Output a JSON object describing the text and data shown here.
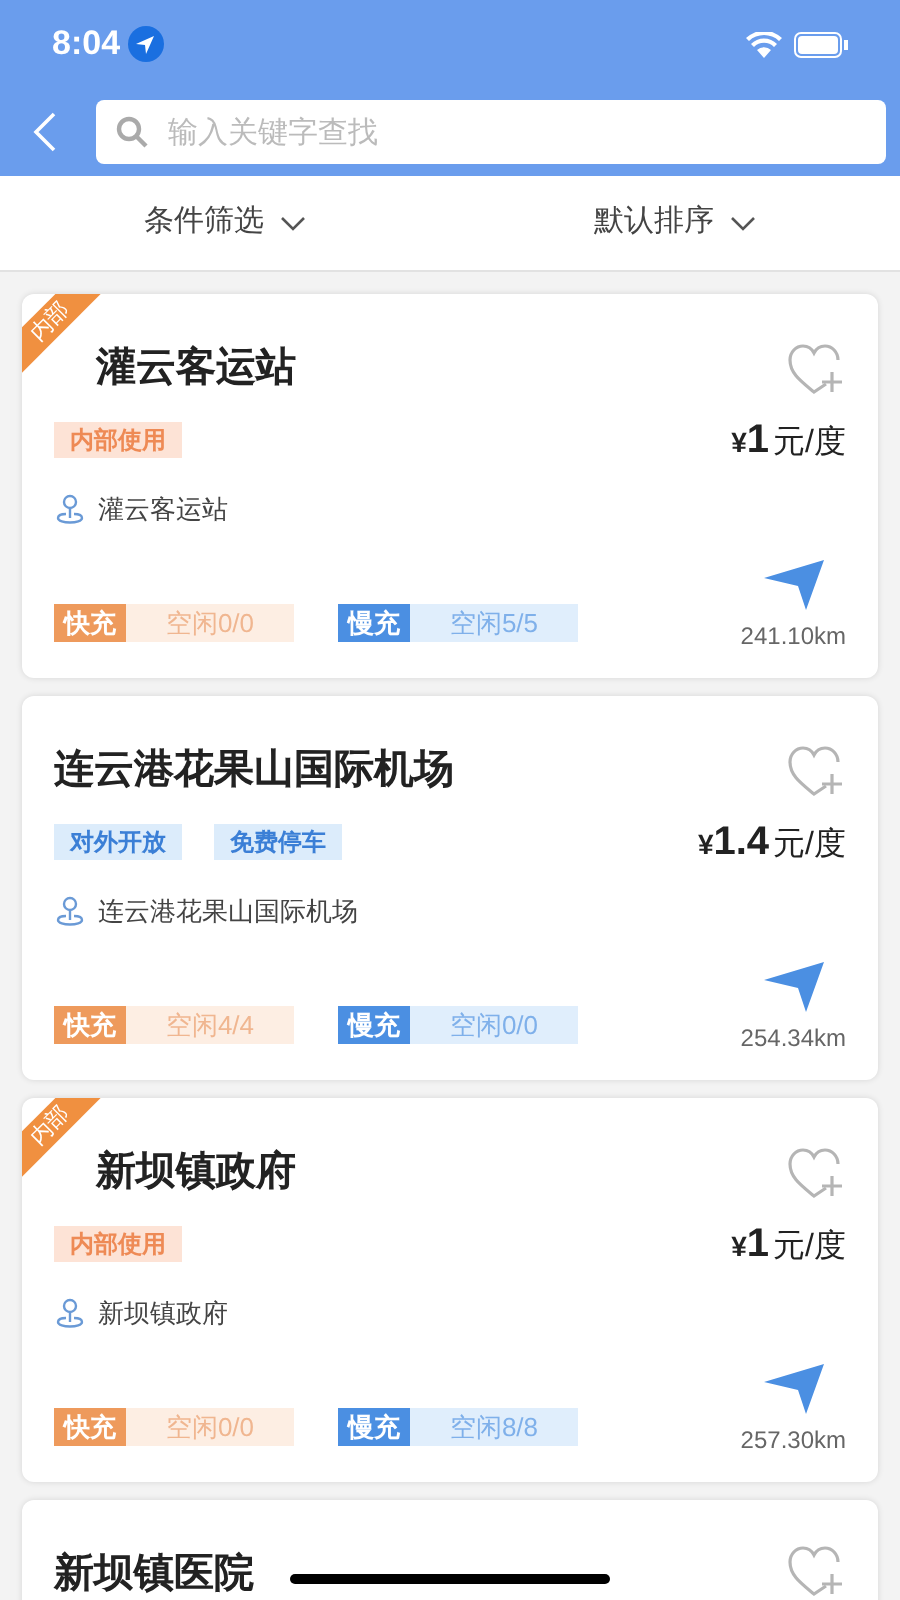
{
  "status_bar": {
    "time": "8:04"
  },
  "search": {
    "placeholder": "输入关键字查找"
  },
  "filters": [
    {
      "label": "条件筛选"
    },
    {
      "label": "默认排序"
    }
  ],
  "stations": [
    {
      "name": "灌云客运站",
      "ribbon": "内部",
      "tags": [
        {
          "label": "内部使用",
          "kind": "internal"
        }
      ],
      "currency": "¥",
      "price": "1",
      "unit": "元/度",
      "address": "灌云客运站",
      "fast": {
        "label": "快充",
        "status": "空闲0/0"
      },
      "slow": {
        "label": "慢充",
        "status": "空闲5/5"
      },
      "distance": "241.10km"
    },
    {
      "name": "连云港花果山国际机场",
      "tags": [
        {
          "label": "对外开放",
          "kind": "open"
        },
        {
          "label": "免费停车",
          "kind": "open"
        }
      ],
      "currency": "¥",
      "price": "1.4",
      "unit": "元/度",
      "address": "连云港花果山国际机场",
      "fast": {
        "label": "快充",
        "status": "空闲4/4"
      },
      "slow": {
        "label": "慢充",
        "status": "空闲0/0"
      },
      "distance": "254.34km"
    },
    {
      "name": "新坝镇政府",
      "ribbon": "内部",
      "tags": [
        {
          "label": "内部使用",
          "kind": "internal"
        }
      ],
      "currency": "¥",
      "price": "1",
      "unit": "元/度",
      "address": "新坝镇政府",
      "fast": {
        "label": "快充",
        "status": "空闲0/0"
      },
      "slow": {
        "label": "慢充",
        "status": "空闲8/8"
      },
      "distance": "257.30km"
    }
  ],
  "partial_station": {
    "name": "新坝镇医院"
  }
}
